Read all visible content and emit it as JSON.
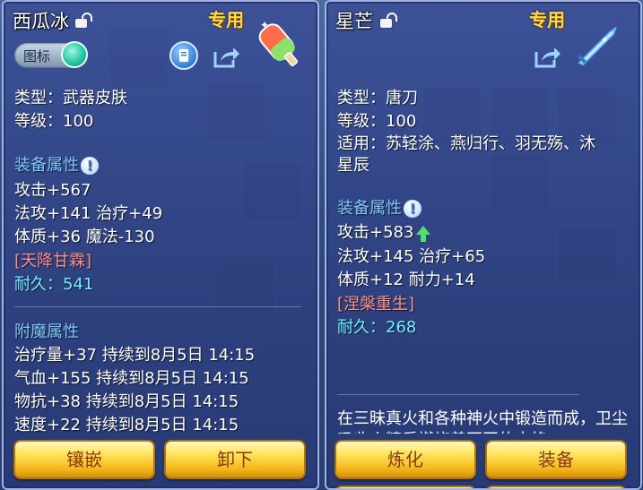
{
  "left": {
    "title": "西瓜冰",
    "special_label": "专用",
    "toggle_label": "图标",
    "type": "类型：武器皮肤",
    "level": "等级：100",
    "section_attrs": "装备属性",
    "attrs": [
      "攻击+567",
      "法攻+141 治疗+49",
      "体质+36 魔法-130"
    ],
    "special_effect": "[天降甘霖]",
    "durability_label": "耐久：",
    "durability_value": "541",
    "section_enchant": "附魔属性",
    "enchants": [
      "治疗量+37 持续到8月5日 14:15",
      "气血+155 持续到8月5日 14:15",
      "物抗+38 持续到8月5日 14:15",
      "速度+22 持续到8月5日 14:15"
    ],
    "buttons": [
      "镶嵌",
      "卸下"
    ]
  },
  "right": {
    "title": "星芒",
    "special_label": "专用",
    "type": "类型：唐刀",
    "level": "等级：100",
    "applicable_line1": "适用：苏轻涂、燕归行、羽无殇、沐",
    "applicable_line2": "星辰",
    "section_attrs": "装备属性",
    "attrs": [
      "攻击+583",
      "法攻+145 治疗+65",
      "体质+12 耐力+14"
    ],
    "special_effect": "[涅槃重生]",
    "durability_label": "耐久：",
    "durability_value": "268",
    "description": "在三昧真火和各种神火中锻造而成，卫尘吸收火精后燃烧着不灭的志格",
    "buttons": [
      "炼化",
      "装备"
    ]
  },
  "icons": {
    "lock": "lock-open-icon",
    "info": "info-icon",
    "share": "share-icon",
    "upgrade_arrow": "up-arrow-icon",
    "item_skin": "popsicle-skin-icon",
    "item_blade": "blade-icon"
  },
  "colors": {
    "section": "#7fc8ff",
    "special_effect": "#ff8f8f",
    "durability": "#6ff0ff",
    "special_label": "#ffd84a",
    "button_text": "#8a3a0c"
  }
}
